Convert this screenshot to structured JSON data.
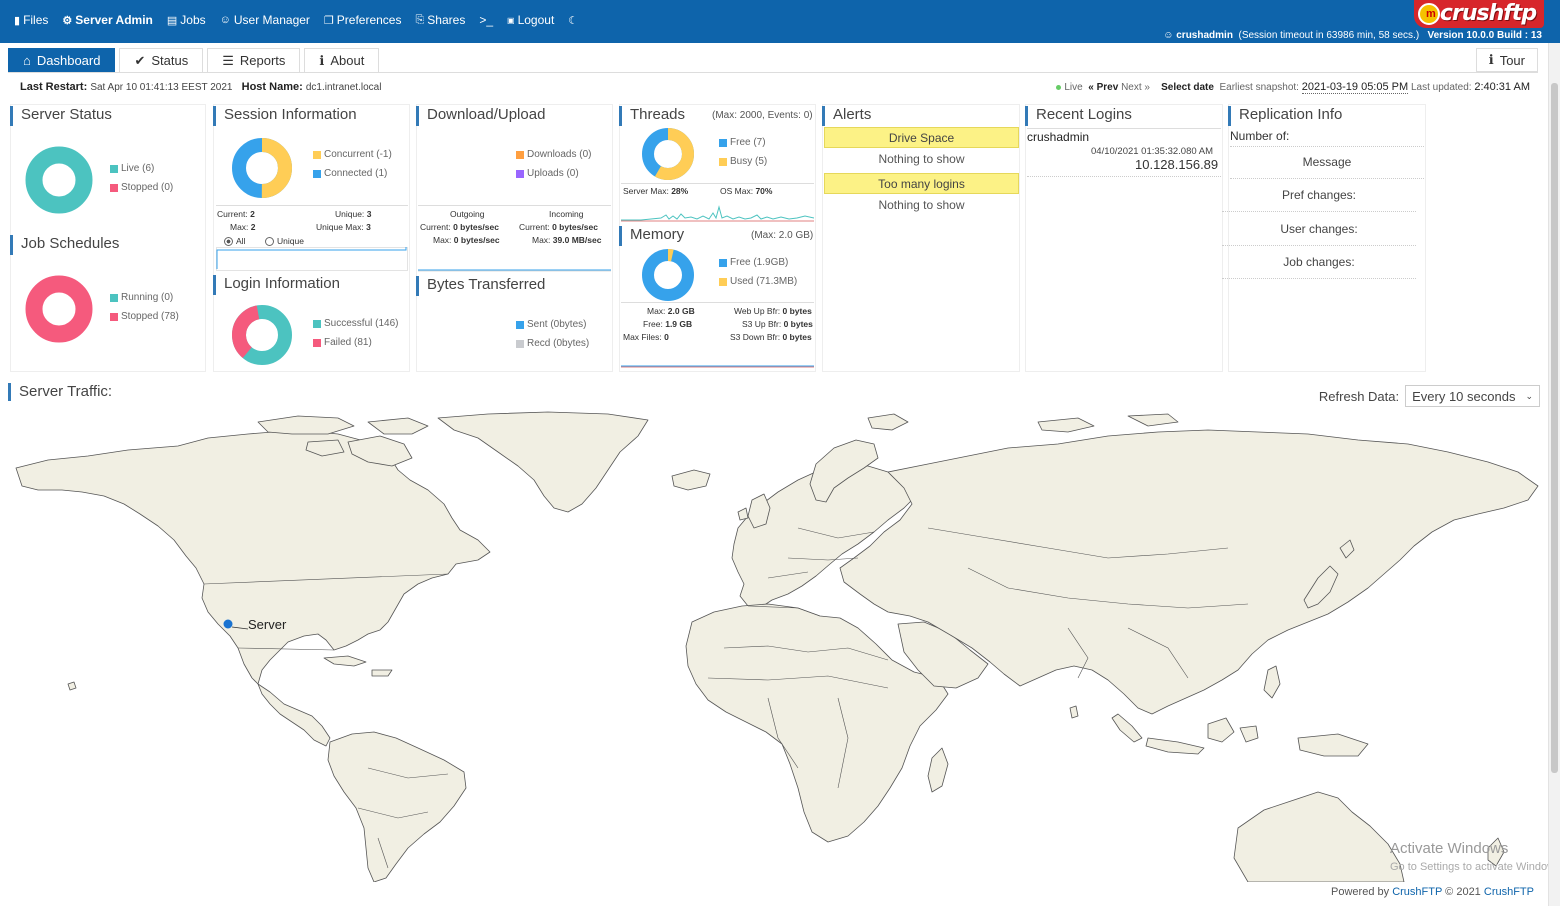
{
  "nav": {
    "items": [
      {
        "icon": "folder-icon",
        "glyph": "🗁",
        "label": "Files"
      },
      {
        "icon": "gear-icon",
        "glyph": "⚙",
        "label": "Server Admin"
      },
      {
        "icon": "jobs-icon",
        "glyph": "▤",
        "label": "Jobs"
      },
      {
        "icon": "user-icon",
        "glyph": "☺",
        "label": "User Manager"
      },
      {
        "icon": "preferences-icon",
        "glyph": "❐",
        "label": "Preferences"
      },
      {
        "icon": "shares-icon",
        "glyph": "⎘",
        "label": "Shares"
      },
      {
        "icon": "terminal-icon",
        "glyph": "",
        "label": ">_"
      },
      {
        "icon": "lock-icon",
        "glyph": "■",
        "label": "Logout"
      },
      {
        "icon": "moon-icon",
        "glyph": "☾",
        "label": ""
      }
    ]
  },
  "user": {
    "name": "crushadmin",
    "session": "(Session timeout in 63986 min, 58 secs.)",
    "version": "Version 10.0.0 Build : 13"
  },
  "logo": {
    "text": "crushftp"
  },
  "tabs": [
    {
      "label": "Dashboard",
      "glyph": "⌂"
    },
    {
      "label": "Status",
      "glyph": "✔"
    },
    {
      "label": "Reports",
      "glyph": "☰"
    },
    {
      "label": "About",
      "glyph": "ℹ"
    }
  ],
  "tour": {
    "label": "Tour",
    "glyph": "ℹ"
  },
  "info": {
    "restart_label": "Last Restart:",
    "restart_value": "Sat Apr 10 01:41:13 EEST 2021",
    "host_label": "Host Name:",
    "host_value": "dc1.intranet.local"
  },
  "snapshot": {
    "live": "Live",
    "prev": "« Prev",
    "next": "Next »",
    "select_date": "Select date",
    "earliest_label": "Earliest snapshot:",
    "earliest_value": "2021-03-19 05:05 PM",
    "updated_label": "Last updated:",
    "updated_value": "2:40:31 AM"
  },
  "colors": {
    "teal": "#4cc3c0",
    "pink": "#f55a7d",
    "blue": "#36a2eb",
    "yellow": "#ffcd56",
    "orange": "#ff9f40",
    "purple": "#9966ff",
    "grey": "#c9cbcf",
    "accent": "#0e64ab"
  },
  "server_status": {
    "title": "Server Status",
    "live": "Live (6)",
    "stopped": "Stopped (0)",
    "live_value": 6,
    "stopped_value": 0
  },
  "job_schedules": {
    "title": "Job Schedules",
    "running": "Running (0)",
    "stopped": "Stopped (78)",
    "running_value": 0,
    "stopped_value": 78
  },
  "session": {
    "title": "Session Information",
    "concurrent": "Concurrent (-1)",
    "connected": "Connected (1)",
    "current_label": "Current:",
    "current_value": "2",
    "max_label": "Max:",
    "max_value": "2",
    "unique_label": "Unique:",
    "unique_value": "3",
    "unique_max_label": "Unique Max:",
    "unique_max_value": "3",
    "radio_all": "All",
    "radio_unique": "Unique"
  },
  "login": {
    "title": "Login Information",
    "successful": "Successful (146)",
    "failed": "Failed (81)",
    "successful_value": 146,
    "failed_value": 81
  },
  "download": {
    "title": "Download/Upload",
    "downloads": "Downloads (0)",
    "uploads": "Uploads (0)",
    "outgoing": "Outgoing",
    "incoming": "Incoming",
    "current_label": "Current:",
    "out_current": "0 bytes/sec",
    "in_current": "0 bytes/sec",
    "max_label": "Max:",
    "out_max": "0 bytes/sec",
    "in_max": "39.0 MB/sec"
  },
  "bytes": {
    "title": "Bytes Transferred",
    "sent": "Sent (0bytes)",
    "recd": "Recd (0bytes)"
  },
  "threads": {
    "title": "Threads",
    "max": "(Max: 2000, Events: 0)",
    "free": "Free (7)",
    "busy": "Busy (5)",
    "free_value": 7,
    "busy_value": 5,
    "server_max_label": "Server Max:",
    "server_max_value": "28%",
    "os_max_label": "OS Max:",
    "os_max_value": "70%"
  },
  "memory": {
    "title": "Memory",
    "max": "(Max: 2.0 GB)",
    "free": "Free (1.9GB)",
    "used": "Used (71.3MB)",
    "free_value": 1.93,
    "used_value": 0.0713,
    "max_label": "Max:",
    "max_value": "2.0 GB",
    "free_label": "Free:",
    "free_amount": "1.9 GB",
    "max_files_label": "Max Files:",
    "max_files_value": "0",
    "web_up_label": "Web Up Bfr:",
    "web_up_value": "0 bytes",
    "s3_up_label": "S3 Up Bfr:",
    "s3_up_value": "0 bytes",
    "s3_down_label": "S3 Down Bfr:",
    "s3_down_value": "0 bytes"
  },
  "alerts": {
    "title": "Alerts",
    "items": [
      {
        "header": "Drive Space",
        "body": "Nothing to show"
      },
      {
        "header": "Too many logins",
        "body": "Nothing to show"
      }
    ]
  },
  "recent": {
    "title": "Recent Logins",
    "user": "crushadmin",
    "time": "04/10/2021 01:35:32.080 AM",
    "ip": "10.128.156.89"
  },
  "replication": {
    "title": "Replication Info",
    "number_of": "Number of:",
    "rows": [
      "Message",
      "Pref changes:",
      "User changes:",
      "Job changes:"
    ]
  },
  "traffic": {
    "title": "Server Traffic:",
    "refresh_label": "Refresh Data:",
    "refresh_value": "Every 10 seconds",
    "server_label": "Server"
  },
  "watermark": {
    "line1": "Activate Windows",
    "line2": "Go to Settings to activate Windows."
  },
  "footer": {
    "powered": "Powered by",
    "brand1": "CrushFTP",
    "copy": "© 2021",
    "brand2": "CrushFTP"
  }
}
